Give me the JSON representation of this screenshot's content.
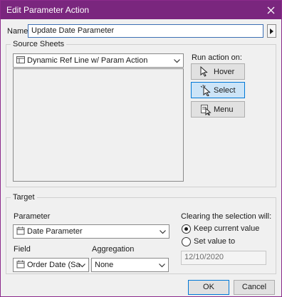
{
  "window": {
    "title": "Edit Parameter Action"
  },
  "name_label": "Name:",
  "name_value": "Update Date Parameter",
  "source": {
    "group_title": "Source Sheets",
    "sheet_dropdown": "Dynamic Ref Line w/ Param Action",
    "run_action_label": "Run action on:",
    "run_buttons": [
      {
        "label": "Hover",
        "selected": false
      },
      {
        "label": "Select",
        "selected": true
      },
      {
        "label": "Menu",
        "selected": false
      }
    ]
  },
  "target": {
    "group_title": "Target",
    "parameter_label": "Parameter",
    "parameter_value": "Date Parameter",
    "field_label": "Field",
    "field_value": "Order Date (Sam...",
    "aggregation_label": "Aggregation",
    "aggregation_value": "None",
    "clearing_label": "Clearing the selection will:",
    "clearing_options": [
      {
        "label": "Keep current value",
        "selected": true
      },
      {
        "label": "Set value to",
        "selected": false
      }
    ],
    "set_value": "12/10/2020"
  },
  "buttons": {
    "ok": "OK",
    "cancel": "Cancel"
  },
  "colors": {
    "titlebar": "#7a267e",
    "selected_button_bg": "#cce4f7",
    "selected_button_border": "#0078d7"
  }
}
